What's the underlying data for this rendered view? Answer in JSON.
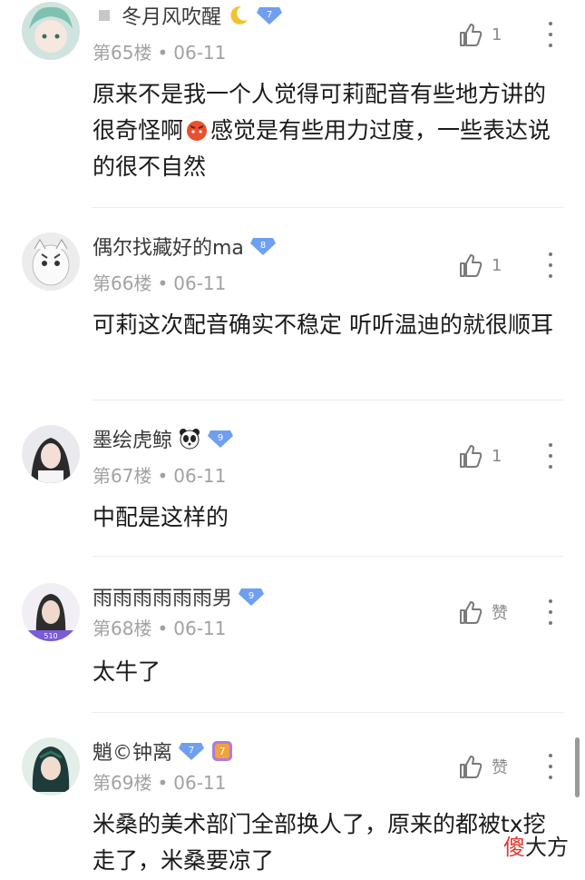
{
  "comments": [
    {
      "username": "冬月风吹醒",
      "level": "7",
      "floor": "第65楼",
      "date": "06-11",
      "likes": "1",
      "text_before": "原来不是我一个人觉得可莉配音有些地方讲的很奇怪啊",
      "text_after": "感觉是有些用力过度，一些表达说的很不自然"
    },
    {
      "username": "偶尔找藏好的ma",
      "level": "8",
      "floor": "第66楼",
      "date": "06-11",
      "likes": "1",
      "text": "可莉这次配音确实不稳定 听听温迪的就很顺耳"
    },
    {
      "username": "墨绘虎鲸",
      "level": "9",
      "floor": "第67楼",
      "date": "06-11",
      "likes": "1",
      "text": "中配是这样的"
    },
    {
      "username": "雨雨雨雨雨雨男",
      "level": "9",
      "floor": "第68楼",
      "date": "06-11",
      "likes": "赞",
      "text": "太牛了"
    },
    {
      "username": "魈©钟离",
      "level": "7",
      "floor": "第69楼",
      "date": "06-11",
      "likes": "赞",
      "text": "米桑的美术部门全部换人了，原来的都被tx挖走了，米桑要凉了"
    }
  ],
  "separator": "•",
  "avatar_badge_text": "510",
  "watermark": {
    "part1": "傻",
    "part2": "大方"
  },
  "colors": {
    "level_badge": "#6f9ff0",
    "meta": "#a2a2a2",
    "text": "#1a1a1a"
  }
}
